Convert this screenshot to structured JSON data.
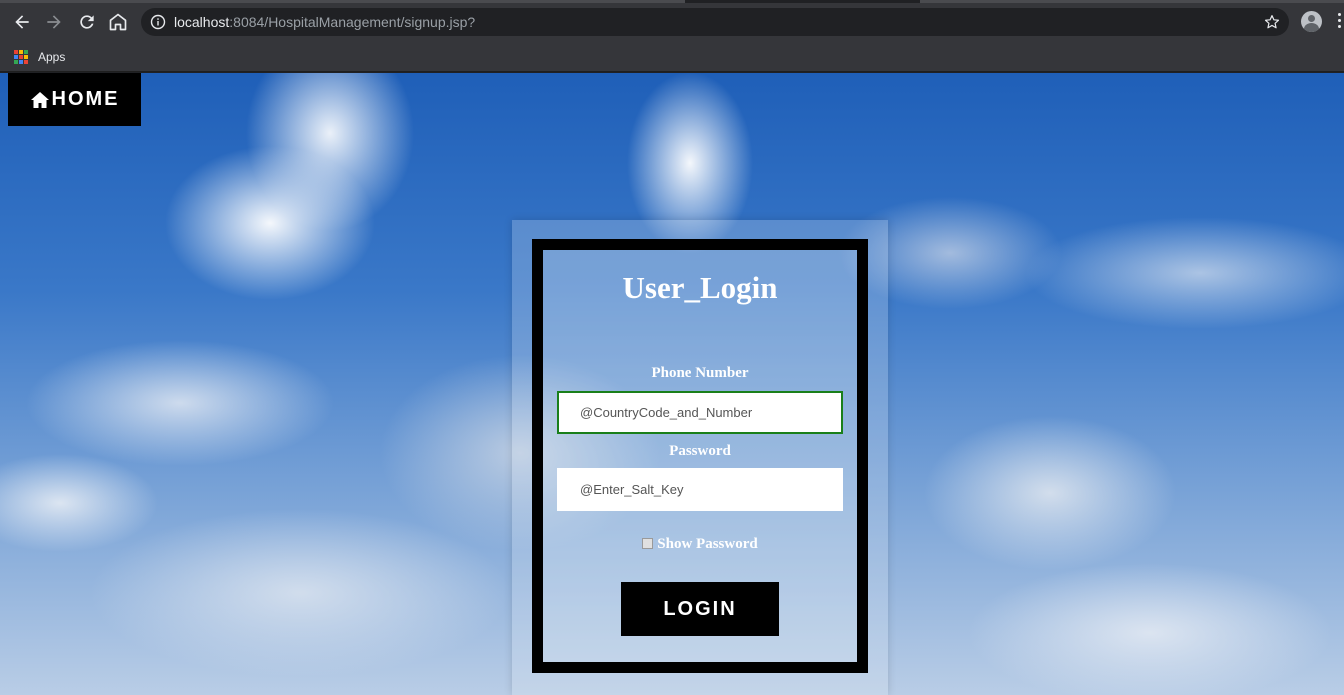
{
  "browser": {
    "url_host": "localhost",
    "url_rest": ":8084/HospitalManagement/signup.jsp?",
    "bookmarks": {
      "apps_label": "Apps"
    }
  },
  "nav": {
    "home_label": "HOME"
  },
  "login": {
    "title": "User_Login",
    "phone_label": "Phone Number",
    "phone_placeholder": "@CountryCode_and_Number",
    "password_label": "Password",
    "password_placeholder": "@Enter_Salt_Key",
    "show_password_label": "Show Password",
    "show_password_checked": false,
    "login_button": "LOGIN"
  },
  "colors": {
    "focus_border": "#1a7f1a",
    "button_bg": "#000000",
    "chrome_bg": "#35363a"
  },
  "icons": [
    "back-arrow-icon",
    "forward-arrow-icon",
    "reload-icon",
    "home-outline-icon",
    "info-icon",
    "star-icon",
    "profile-icon",
    "more-menu-icon",
    "apps-grid-icon",
    "home-icon"
  ]
}
